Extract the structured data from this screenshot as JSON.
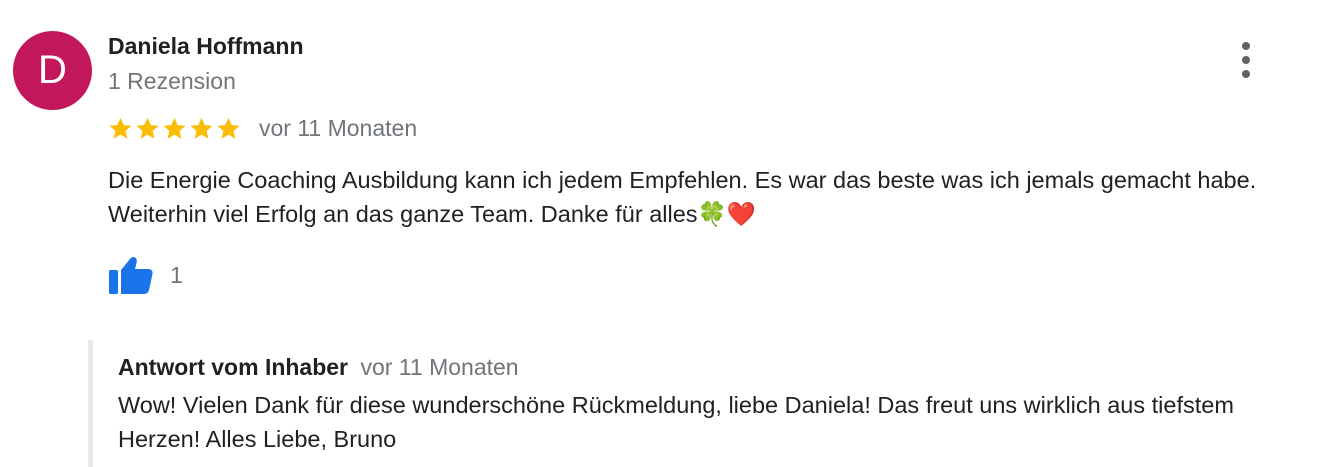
{
  "review": {
    "avatar_letter": "D",
    "avatar_color": "#c2185b",
    "author_name": "Daniela Hoffmann",
    "review_count_label": "1 Rezension",
    "rating": 5,
    "rating_max": 5,
    "star_color": "#fbbc04",
    "time_ago": "vor 11 Monaten",
    "text": "Die Energie Coaching Ausbildung kann ich jedem Empfehlen. Es war das beste was ich jemals gemacht habe. Weiterhin viel Erfolg an das ganze Team. Danke für alles🍀❤️",
    "likes": "1",
    "like_icon_color": "#1a73e8",
    "menu_icon": "more-vert-icon"
  },
  "owner_reply": {
    "label": "Antwort vom Inhaber",
    "time_ago": "vor 11 Monaten",
    "text": "Wow! Vielen Dank für diese wunderschöne Rückmeldung, liebe Daniela! Das freut uns wirklich aus tiefstem Herzen! Alles Liebe, Bruno"
  }
}
